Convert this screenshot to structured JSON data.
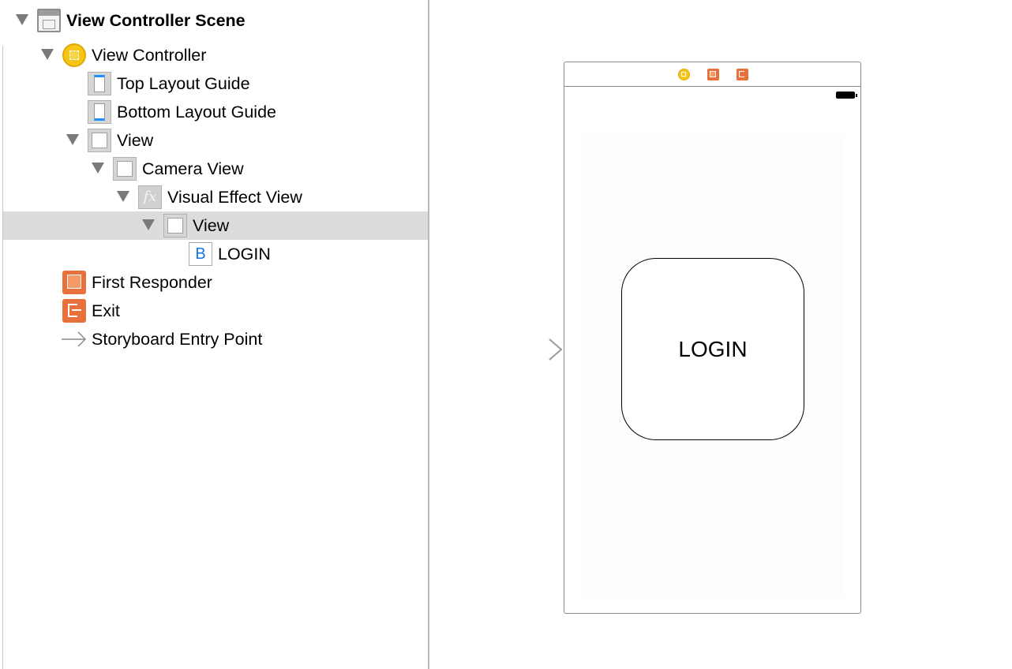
{
  "outline": {
    "items": [
      {
        "label": "View Controller Scene",
        "icon": "scene-icon",
        "expanded": true
      },
      {
        "label": "View Controller",
        "icon": "view-controller-icon",
        "expanded": true
      },
      {
        "label": "Top Layout Guide",
        "icon": "top-layout-guide-icon"
      },
      {
        "label": "Bottom Layout Guide",
        "icon": "bottom-layout-guide-icon"
      },
      {
        "label": "View",
        "icon": "view-icon",
        "expanded": true
      },
      {
        "label": "Camera View",
        "icon": "view-icon",
        "expanded": true
      },
      {
        "label": "Visual Effect View",
        "icon": "visual-effect-icon",
        "icon_glyph": "fx",
        "expanded": true
      },
      {
        "label": "View",
        "icon": "view-icon",
        "expanded": true,
        "selected": true
      },
      {
        "label": "LOGIN",
        "icon": "button-icon",
        "icon_glyph": "B"
      },
      {
        "label": "First Responder",
        "icon": "first-responder-icon"
      },
      {
        "label": "Exit",
        "icon": "exit-icon"
      },
      {
        "label": "Storyboard Entry Point",
        "icon": "arrow-right-icon"
      }
    ]
  },
  "canvas": {
    "login_button_label": "LOGIN",
    "dock_icons": [
      "view-controller-icon",
      "first-responder-icon",
      "exit-icon"
    ]
  },
  "colors": {
    "selection": "#dcdcdc",
    "vc_icon": "#f5c518",
    "responder_icon": "#e8703a",
    "button_glyph": "#1a73e8"
  }
}
